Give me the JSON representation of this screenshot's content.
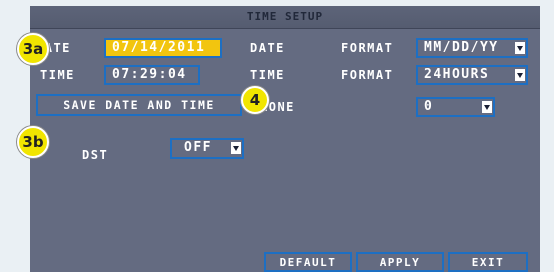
{
  "window": {
    "title": "TIME SETUP"
  },
  "date": {
    "label": "DATE",
    "value": "07/14/2011"
  },
  "time": {
    "label": "TIME",
    "value": "07:29:04"
  },
  "date_format": {
    "label_a": "DATE",
    "label_b": "FORMAT",
    "value": "MM/DD/YY"
  },
  "time_format": {
    "label_a": "TIME",
    "label_b": "FORMAT",
    "value": "24HOURS"
  },
  "save_button": {
    "label": "SAVE DATE AND TIME"
  },
  "time_zone": {
    "label": "ZONE",
    "value": "0"
  },
  "dst": {
    "label": "DST",
    "value": "OFF"
  },
  "footer": {
    "default_label": "DEFAULT",
    "apply_label": "APPLY",
    "exit_label": "EXIT"
  },
  "callouts": {
    "c3a": "3a",
    "c3b": "3b",
    "c4": "4"
  },
  "colors": {
    "panel": "#646b81",
    "border": "#1d6fc3",
    "highlight": "#f2c50f",
    "callout": "#f1e500"
  }
}
